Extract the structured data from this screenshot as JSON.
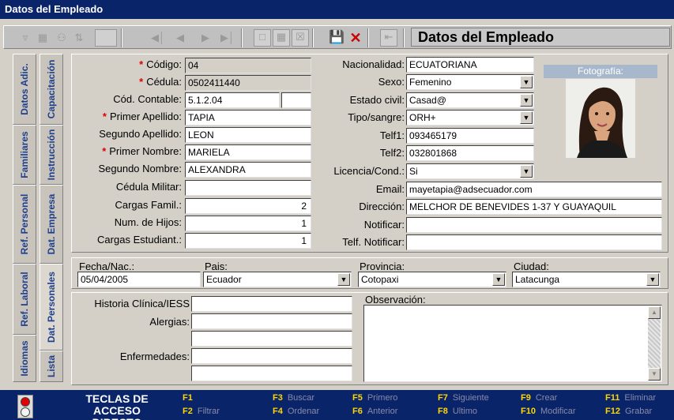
{
  "window": {
    "title": "Datos del Empleado"
  },
  "toolbar": {
    "header_title": "Datos del Empleado",
    "icons": [
      "filter-icon",
      "edit-icon",
      "search-icon",
      "sort-icon",
      "blank-icon",
      "first-icon",
      "prev-icon",
      "next-icon",
      "last-icon",
      "new-icon",
      "edit-doc-icon",
      "delete-doc-icon",
      "save-icon",
      "cancel-icon",
      "exit-icon"
    ]
  },
  "left_tabs": [
    "Datos Adic.",
    "Familiares",
    "Ref. Personal",
    "Ref. Laboral",
    "Idiomas"
  ],
  "inner_tabs": [
    "Capacitación",
    "Instrucción",
    "Dat. Empresa",
    "Dat. Personales",
    "Lista"
  ],
  "form": {
    "codigo": {
      "label": "Código:",
      "value": "04"
    },
    "cedula": {
      "label": "Cédula:",
      "value": "0502411440"
    },
    "cod_contable": {
      "label": "Cód. Contable:",
      "value": "5.1.2.04",
      "value2": ""
    },
    "primer_apellido": {
      "label": "Primer Apellido:",
      "value": "TAPIA"
    },
    "segundo_apellido": {
      "label": "Segundo Apellido:",
      "value": "LEON"
    },
    "primer_nombre": {
      "label": "Primer Nombre:",
      "value": "MARIELA"
    },
    "segundo_nombre": {
      "label": "Segundo Nombre:",
      "value": "ALEXANDRA"
    },
    "cedula_militar": {
      "label": "Cédula Militar:",
      "value": ""
    },
    "cargas_famil": {
      "label": "Cargas Famil.:",
      "value": "2"
    },
    "num_hijos": {
      "label": "Num. de Hijos:",
      "value": "1"
    },
    "cargas_estudiant": {
      "label": "Cargas Estudiant.:",
      "value": "1"
    },
    "nacionalidad": {
      "label": "Nacionalidad:",
      "value": "ECUATORIANA"
    },
    "sexo": {
      "label": "Sexo:",
      "value": "Femenino"
    },
    "estado_civil": {
      "label": "Estado civil:",
      "value": "Casad@"
    },
    "tipo_sangre": {
      "label": "Tipo/sangre:",
      "value": "ORH+"
    },
    "telf1": {
      "label": "Telf1:",
      "value": "093465179"
    },
    "telf2": {
      "label": "Telf2:",
      "value": "032801868"
    },
    "licencia": {
      "label": "Licencia/Cond.:",
      "value": "Si"
    },
    "email": {
      "label": "Email:",
      "value": "mayetapia@adsecuador.com"
    },
    "direccion": {
      "label": "Dirección:",
      "value": "MELCHOR DE BENEVIDES 1-37 Y GUAYAQUIL"
    },
    "notificar": {
      "label": "Notificar:",
      "value": ""
    },
    "telf_notificar": {
      "label": "Telf. Notificar:",
      "value": ""
    },
    "required_mark": "*",
    "photo_label": "Fotografía:"
  },
  "location": {
    "fecha_nac": {
      "label": "Fecha/Nac.:",
      "value": "05/04/2005"
    },
    "pais": {
      "label": "Pais:",
      "value": "Ecuador"
    },
    "provincia": {
      "label": "Provincia:",
      "value": "Cotopaxi"
    },
    "ciudad": {
      "label": "Ciudad:",
      "value": "Latacunga"
    }
  },
  "medical": {
    "historia": {
      "label": "Historia Clínica/IESS",
      "value": ""
    },
    "alergias": {
      "label": "Alergias:",
      "value": ""
    },
    "enfermedades": {
      "label": "Enfermedades:",
      "value": ""
    },
    "observacion": {
      "label": "Observación:",
      "value": ""
    }
  },
  "footer": {
    "title_line1": "TECLAS DE",
    "title_line2": "ACCESO DIRECTO",
    "keys": [
      {
        "key": "F1",
        "action": ""
      },
      {
        "key": "F2",
        "action": "Filtrar"
      },
      {
        "key": "F3",
        "action": "Buscar"
      },
      {
        "key": "F4",
        "action": "Ordenar"
      },
      {
        "key": "F5",
        "action": "Primero"
      },
      {
        "key": "F6",
        "action": "Anterior"
      },
      {
        "key": "F7",
        "action": "Siguiente"
      },
      {
        "key": "F8",
        "action": "Ultimo"
      },
      {
        "key": "F9",
        "action": "Crear"
      },
      {
        "key": "F10",
        "action": "Modificar"
      },
      {
        "key": "F11",
        "action": "Eliminar"
      },
      {
        "key": "F12",
        "action": "Grabar"
      }
    ]
  },
  "colors": {
    "title_bg": "#0a246a",
    "tab_text": "#1f3f8f",
    "required": "#dd0000",
    "key_label": "#ffd700"
  }
}
